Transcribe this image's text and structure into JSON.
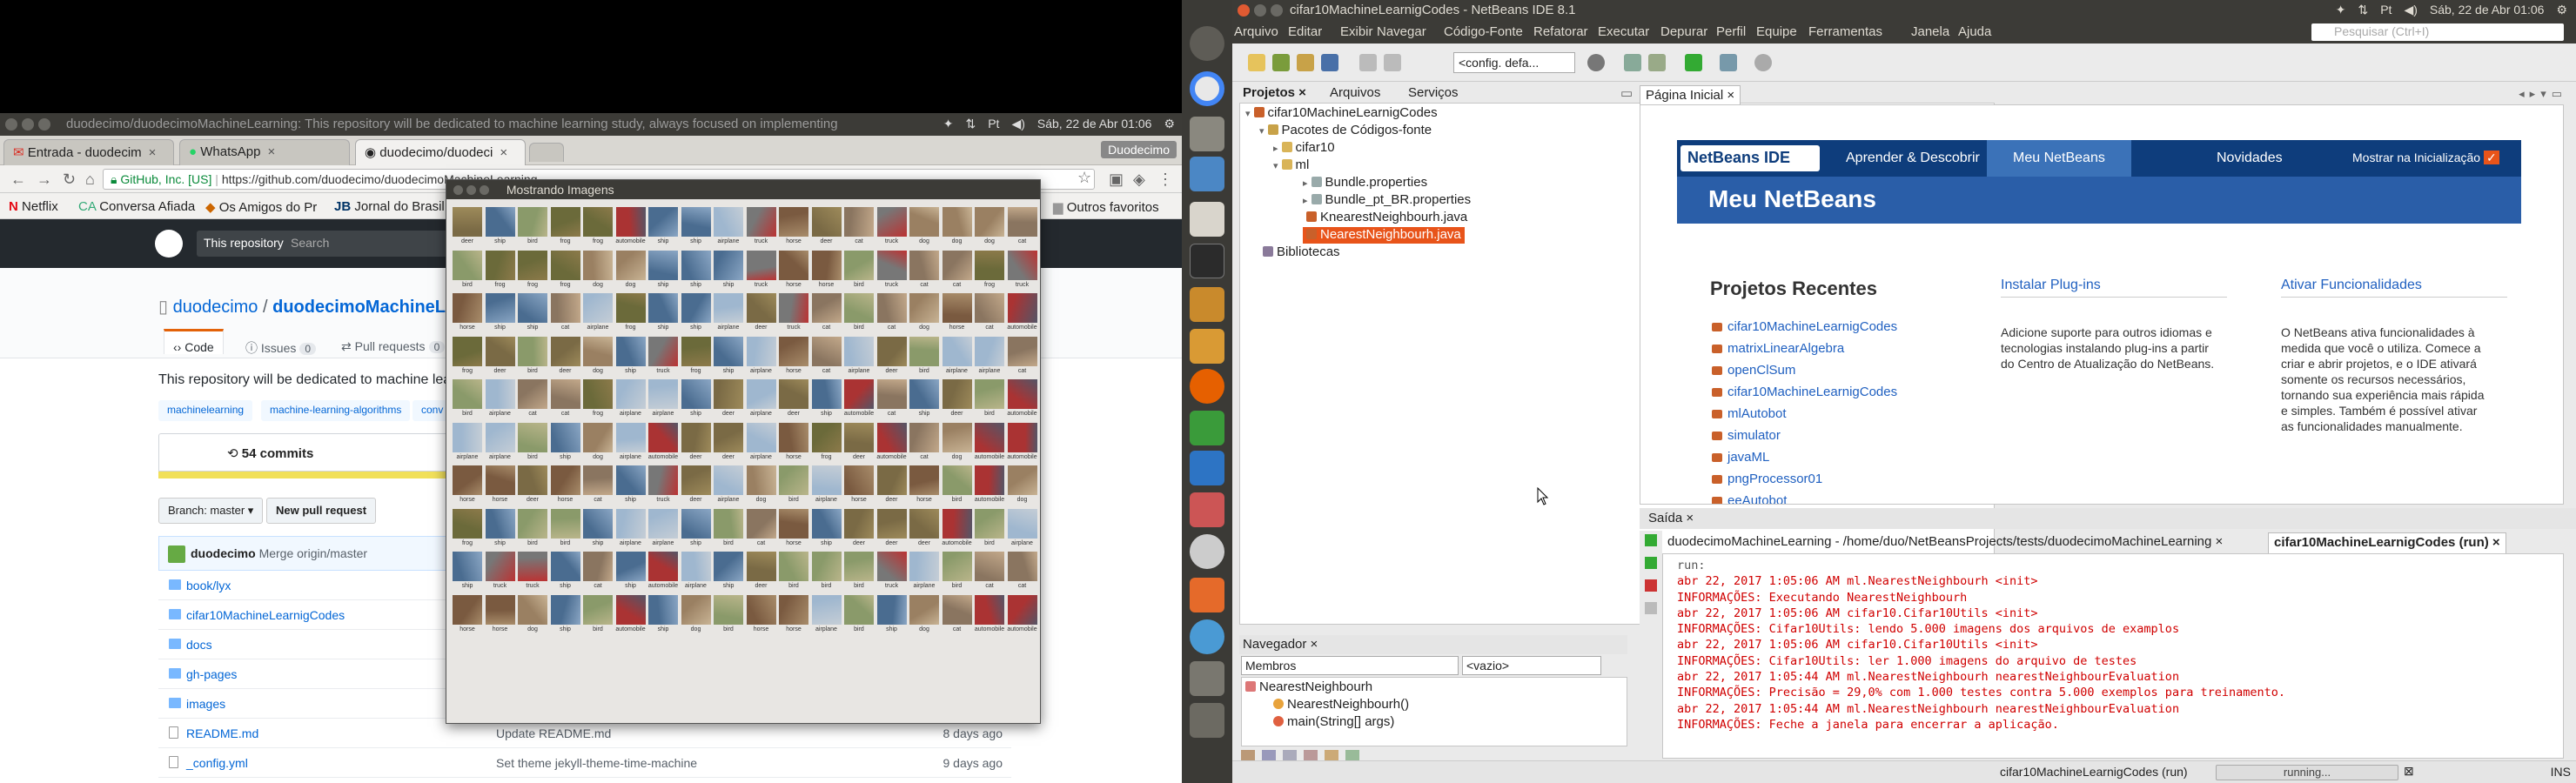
{
  "chrome": {
    "title": "duodecimo/duodecimoMachineLearning: This repository will be dedicated to machine learning study, always focused on implementing",
    "tray": {
      "date": "Sáb, 22 de Abr 01:06"
    },
    "tabs": [
      {
        "label": "Entrada - duodecim",
        "icon": "gmail-icon"
      },
      {
        "label": "WhatsApp",
        "icon": "whatsapp-icon"
      },
      {
        "label": "duodecimo/duodeci",
        "icon": "github-icon"
      }
    ],
    "user_badge": "Duodecimo",
    "url": {
      "org": "GitHub, Inc. [US]",
      "href": "https://github.com/duodecimo/duodecimoMachineLearning"
    },
    "bookmarks": [
      "Netflix",
      "Conversa Afiada",
      "Os Amigos do Pr",
      "Jornal do Brasil",
      "Outros favoritos"
    ],
    "github": {
      "repo_menu": "This repository",
      "search_placeholder": "Search",
      "owner": "duodecimo",
      "separator": "/",
      "repo": "duodecimoMachineLear",
      "tabs": [
        {
          "label": "Code"
        },
        {
          "label": "Issues",
          "count": "0"
        },
        {
          "label": "Pull requests",
          "count": "0"
        }
      ],
      "description": "This repository will be dedicated to machine lea",
      "topics": [
        "machinelearning",
        "machine-learning-algorithms",
        "conv"
      ],
      "commits": "54 commits",
      "branch": "Branch: master ▾",
      "new_pr": "New pull request",
      "latest": {
        "author": "duodecimo",
        "message": "Merge origin/master"
      },
      "files": [
        {
          "name": "book/lyx",
          "type": "dir",
          "message": "",
          "age": ""
        },
        {
          "name": "cifar10MachineLearnigCodes",
          "type": "dir",
          "message": "",
          "age": ""
        },
        {
          "name": "docs",
          "type": "dir",
          "message": "",
          "age": ""
        },
        {
          "name": "gh-pages",
          "type": "dir",
          "message": "",
          "age": ""
        },
        {
          "name": "images",
          "type": "dir",
          "message": "",
          "age": ""
        },
        {
          "name": "README.md",
          "type": "file",
          "message": "Update README.md",
          "age": "8 days ago"
        },
        {
          "name": "_config.yml",
          "type": "file",
          "message": "Set theme jekyll-theme-time-machine",
          "age": "9 days ago"
        }
      ]
    }
  },
  "viewer": {
    "title": "Mostrando Imagens",
    "labels": [
      "deer",
      "ship",
      "bird",
      "frog",
      "frog",
      "automobile",
      "ship",
      "ship",
      "airplane",
      "truck",
      "horse",
      "deer",
      "cat",
      "truck",
      "dog",
      "dog",
      "dog",
      "cat",
      "bird",
      "frog",
      "frog",
      "frog",
      "dog",
      "dog",
      "ship",
      "ship",
      "ship",
      "truck",
      "horse",
      "horse",
      "bird",
      "truck",
      "cat",
      "cat",
      "frog",
      "truck",
      "horse",
      "ship",
      "ship",
      "cat",
      "airplane",
      "frog",
      "ship",
      "ship",
      "airplane",
      "deer",
      "truck",
      "cat",
      "bird",
      "cat",
      "dog",
      "horse",
      "cat",
      "automobile",
      "frog",
      "deer",
      "bird",
      "deer",
      "dog",
      "ship",
      "truck",
      "frog",
      "ship",
      "airplane",
      "horse",
      "cat",
      "airplane",
      "deer",
      "bird",
      "airplane",
      "airplane",
      "cat",
      "bird",
      "airplane",
      "cat",
      "cat",
      "frog",
      "airplane",
      "airplane",
      "ship",
      "deer",
      "airplane",
      "deer",
      "ship",
      "automobile",
      "cat",
      "ship",
      "deer",
      "bird",
      "automobile",
      "airplane",
      "airplane",
      "bird",
      "ship",
      "dog",
      "airplane",
      "automobile",
      "deer",
      "deer",
      "airplane",
      "horse",
      "frog",
      "deer",
      "automobile",
      "cat",
      "dog",
      "automobile",
      "automobile",
      "horse",
      "horse",
      "deer",
      "horse",
      "cat",
      "ship",
      "truck",
      "deer",
      "airplane",
      "dog",
      "bird",
      "airplane",
      "horse",
      "deer",
      "horse",
      "bird",
      "automobile",
      "dog",
      "frog",
      "ship",
      "bird",
      "bird",
      "ship",
      "airplane",
      "airplane",
      "ship",
      "bird",
      "cat",
      "horse",
      "ship",
      "deer",
      "deer",
      "deer",
      "automobile",
      "bird",
      "airplane",
      "ship",
      "truck",
      "truck",
      "ship",
      "cat",
      "ship",
      "automobile",
      "airplane",
      "ship",
      "deer",
      "bird",
      "bird",
      "bird",
      "truck",
      "airplane",
      "bird",
      "cat",
      "cat",
      "horse",
      "horse",
      "dog",
      "ship",
      "bird",
      "automobile",
      "ship",
      "dog",
      "bird",
      "horse",
      "horse",
      "airplane",
      "bird",
      "ship",
      "dog",
      "cat",
      "automobile",
      "automobile"
    ]
  },
  "netbeans": {
    "title": "cifar10MachineLearnigCodes - NetBeans IDE 8.1",
    "menu": [
      "Arquivo",
      "Editar",
      "Exibir",
      "Navegar",
      "Código-Fonte",
      "Refatorar",
      "Executar",
      "Depurar",
      "Perfil",
      "Equipe",
      "Ferramentas",
      "Janela",
      "Ajuda"
    ],
    "tray": {
      "date": "Sáb, 22 de Abr 01:06"
    },
    "search_placeholder": "Pesquisar (Ctrl+I)",
    "config": "<config. defa...",
    "panel_tabs": [
      "Projetos",
      "Arquivos",
      "Serviços"
    ],
    "tree": [
      {
        "label": "cifar10MachineLearnigCodes",
        "level": 0,
        "icon": "project-icon"
      },
      {
        "label": "Pacotes de Códigos-fonte",
        "level": 1,
        "icon": "package-folder-icon"
      },
      {
        "label": "cifar10",
        "level": 2,
        "icon": "package-icon"
      },
      {
        "label": "ml",
        "level": 2,
        "icon": "package-icon"
      },
      {
        "label": "Bundle.properties",
        "level": 3,
        "icon": "properties-icon"
      },
      {
        "label": "Bundle_pt_BR.properties",
        "level": 3,
        "icon": "properties-icon"
      },
      {
        "label": "KnearestNeighbourh.java",
        "level": 3,
        "icon": "java-icon"
      },
      {
        "label": "NearestNeighbourh.java",
        "level": 3,
        "icon": "java-icon",
        "selected": true
      },
      {
        "label": "Bibliotecas",
        "level": 1,
        "icon": "library-icon"
      }
    ],
    "navigator": {
      "title": "Navegador",
      "combo": "Membros",
      "filter": "<vazio>",
      "items": [
        "NearestNeighbourh",
        "NearestNeighbourh()",
        "main(String[] args)"
      ]
    },
    "start_tab": "Página Inicial",
    "start": {
      "logo": "NetBeans IDE",
      "nav": [
        "Aprender & Descobrir",
        "Meu NetBeans",
        "Novidades",
        "Mostrar na Inicialização"
      ],
      "banner": "Meu NetBeans",
      "recent_title": "Projetos Recentes",
      "recent": [
        "cifar10MachineLearnigCodes",
        "matrixLinearAlgebra",
        "openClSum",
        "cifar10MachineLearnigCodes",
        "mlAutobot",
        "simulator",
        "javaML",
        "pngProcessor01",
        "eeAutobot"
      ],
      "plugins_title": "Instalar Plug-ins",
      "plugins_text": "Adicione suporte para outros idiomas e tecnologias instalando plug-ins a partir do Centro de Atualização do NetBeans.",
      "features_title": "Ativar Funcionalidades",
      "features_text": "O NetBeans ativa funcionalidades à medida que você o utiliza. Comece a criar e abrir projetos, e o IDE ativará somente os recursos necessários, tornando sua experiência mais rápida e simples. Também é possível ativar as funcionalidades manualmente."
    },
    "output": {
      "title": "Saída",
      "tabs": [
        "duodecimoMachineLearning - /home/duo/NetBeansProjects/tests/duodecimoMachineLearning",
        "cifar10MachineLearnigCodes (run)"
      ],
      "lines": [
        {
          "text": "run:",
          "kind": "run"
        },
        {
          "text": "abr 22, 2017 1:05:06 AM ml.NearestNeighbourh <init>",
          "kind": "err"
        },
        {
          "text": "INFORMAÇÕES: Executando NearestNeighbourh",
          "kind": "err"
        },
        {
          "text": "abr 22, 2017 1:05:06 AM cifar10.Cifar10Utils <init>",
          "kind": "err"
        },
        {
          "text": "INFORMAÇÕES: Cifar10Utils: lendo 5.000 imagens dos arquivos de examplos",
          "kind": "err"
        },
        {
          "text": "abr 22, 2017 1:05:06 AM cifar10.Cifar10Utils <init>",
          "kind": "err"
        },
        {
          "text": "INFORMAÇÕES: Cifar10Utils: ler 1.000 imagens do arquivo de testes",
          "kind": "err"
        },
        {
          "text": "abr 22, 2017 1:05:44 AM ml.NearestNeighbourh nearestNeighbourEvaluation",
          "kind": "err"
        },
        {
          "text": "INFORMAÇÕES: Precisão = 29,0% com 1.000 testes contra 5.000 exemplos para treinamento.",
          "kind": "err"
        },
        {
          "text": "abr 22, 2017 1:05:44 AM ml.NearestNeighbourh nearestNeighbourEvaluation",
          "kind": "err"
        },
        {
          "text": "INFORMAÇÕES: Feche a janela para encerrar a aplicação.",
          "kind": "err"
        }
      ]
    },
    "status": {
      "project": "cifar10MachineLearnigCodes (run)",
      "progress": "running...",
      "mode": "INS"
    }
  }
}
